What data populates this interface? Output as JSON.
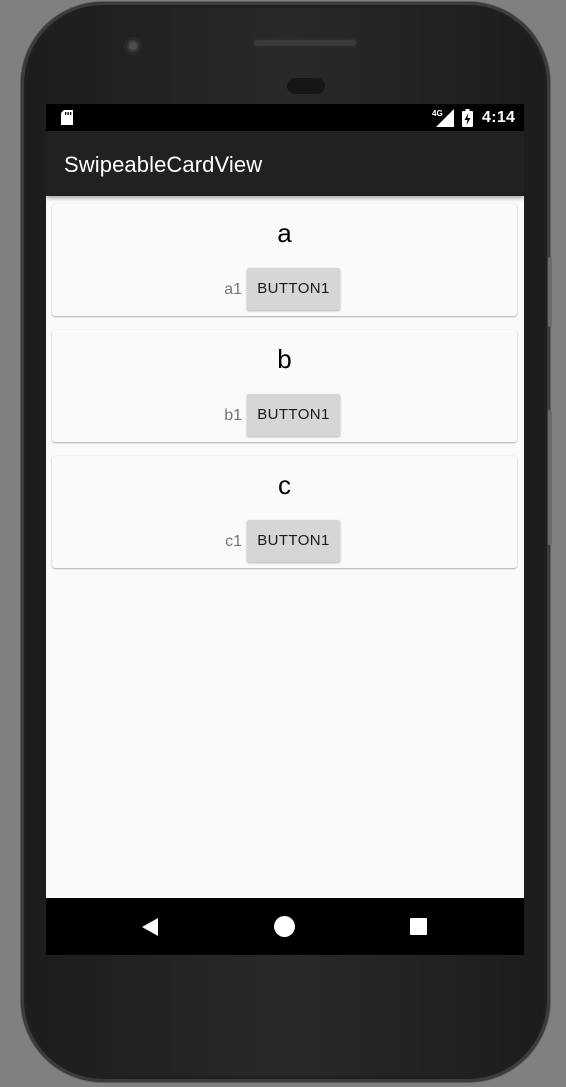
{
  "status_bar": {
    "network": "4G",
    "time": "4:14"
  },
  "app_bar": {
    "title": "SwipeableCardView"
  },
  "cards": [
    {
      "title": "a",
      "subtitle": "a1",
      "button_label": "BUTTON1"
    },
    {
      "title": "b",
      "subtitle": "b1",
      "button_label": "BUTTON1"
    },
    {
      "title": "c",
      "subtitle": "c1",
      "button_label": "BUTTON1"
    }
  ],
  "nav_bar": {
    "icons": [
      "back-icon",
      "home-icon",
      "recent-apps-icon"
    ]
  },
  "colors": {
    "status_bar": "#000000",
    "app_bar": "#212121",
    "background": "#fafafa",
    "button": "#d6d6d6",
    "nav_bar": "#000000"
  }
}
